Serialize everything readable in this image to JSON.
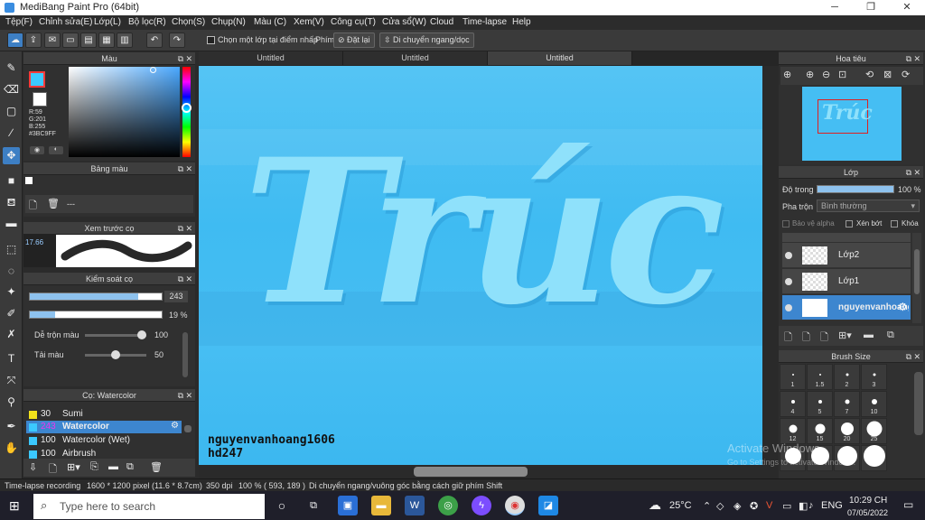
{
  "window": {
    "title": "MediBang Paint Pro (64bit)",
    "min": "─",
    "max": "❐",
    "close": "✕"
  },
  "menu": [
    "Tệp(F)",
    "Chỉnh sửa(E)",
    "Lớp(L)",
    "Bộ lọc(R)",
    "Chọn(S)",
    "Chụp(N)",
    "Màu (C)",
    "Xem(V)",
    "Công cụ(T)",
    "Cửa sổ(W)",
    "Cloud",
    "Time-lapse",
    "Help"
  ],
  "toolbar": {
    "select_layer_click": "Chọn một lớp tại điểm nhấp",
    "key_label": "Phím",
    "reset": "Đặt lại",
    "move_hv": "Di chuyển ngang/dọc"
  },
  "tabs": [
    "Untitled",
    "Untitled",
    "Untitled"
  ],
  "color_panel": {
    "title": "Màu",
    "r": "R:59",
    "g": "G:201",
    "b": "B:255",
    "hex": "#3BC9FF",
    "primary": "#3bc9ff",
    "secondary": "#ffffff"
  },
  "palette_panel": {
    "title": "Bảng màu",
    "name": "---"
  },
  "brush_preview": {
    "title": "Xem trước cọ",
    "size": "17.66"
  },
  "brush_control": {
    "title": "Kiểm soát cọ",
    "size_value": "243",
    "size_frac": 0.82,
    "opacity_value": "19 %",
    "opacity_frac": 0.19,
    "blend_label": "Dễ trộn màu",
    "blend_value": "100",
    "blend_frac": 1.0,
    "amount_label": "Tải màu",
    "amount_value": "50",
    "amount_frac": 0.5
  },
  "brush_list": {
    "title": "Cọ: Watercolor",
    "items": [
      {
        "num": "30",
        "name": "Sumi",
        "color": "#f2e21b"
      },
      {
        "num": "243",
        "name": "Watercolor",
        "color": "#3bc9ff"
      },
      {
        "num": "100",
        "name": "Watercolor (Wet)",
        "color": "#3bc9ff"
      },
      {
        "num": "100",
        "name": "Airbrush",
        "color": "#3bc9ff"
      }
    ]
  },
  "canvas": {
    "art_text": "Trúc",
    "watermark1": "nguyenvanhoang1606",
    "watermark2": "hd247"
  },
  "navigator": {
    "title": "Hoa tiêu"
  },
  "layers": {
    "title": "Lớp",
    "opacity_label": "Độ trong",
    "opacity_value": "100 %",
    "opacity_frac": 1.0,
    "blend_label": "Pha trộn",
    "blend_value": "Bình thường",
    "protect_alpha": "Bảo vệ alpha",
    "clipping": "Xén bớt",
    "lock": "Khóa",
    "items": [
      "Lớp2",
      "Lớp1",
      "nguyenvanhoang1606"
    ]
  },
  "brush_size": {
    "title": "Brush Size",
    "values": [
      "1",
      "1.5",
      "2",
      "3",
      "4",
      "5",
      "7",
      "10",
      "12",
      "15",
      "20",
      "25"
    ]
  },
  "activate": {
    "line1": "Activate Windows",
    "line2": "Go to Settings to activate Windows."
  },
  "status": {
    "timelapse": "Time-lapse recording",
    "size": "1600 * 1200 pixel  (11.6 * 8.7cm)",
    "dpi": "350 dpi",
    "zoom": "100 %",
    "coords": "( 593, 189 )",
    "hint": "Di chuyển ngang/vuông góc bằng cách giữ phím Shift"
  },
  "taskbar": {
    "search": "Type here to search",
    "weather": "25°C",
    "lang": "ENG",
    "time": "10:29 CH",
    "date": "07/05/2022"
  }
}
